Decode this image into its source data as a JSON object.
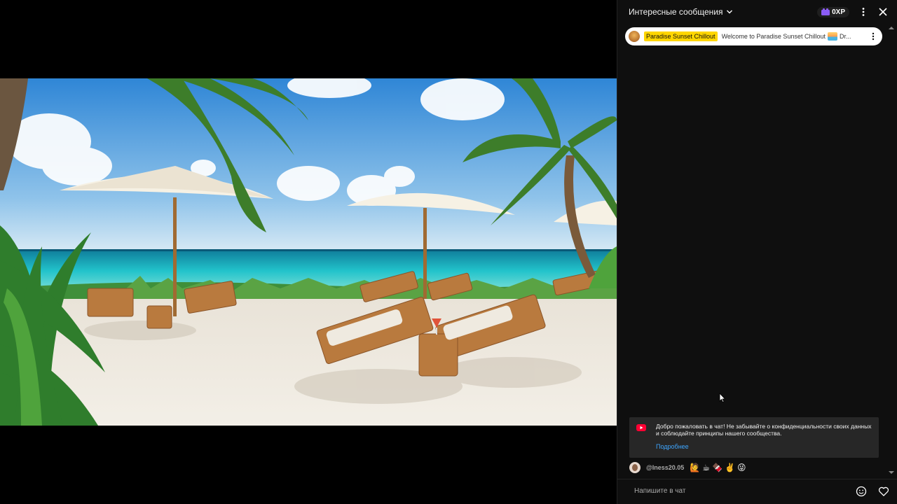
{
  "chat": {
    "header": {
      "title": "Интересные сообщения",
      "xp_label": "0XP"
    },
    "pinned": {
      "channel": "Paradise Sunset Chillout",
      "message": "Welcome to Paradise Sunset Chillout",
      "message_tail": "Dr..."
    },
    "welcome": {
      "text": "Добро пожаловать в чат! Не забывайте о конфиденциальности своих данных и соблюдайте принципы нашего сообщества.",
      "link": "Подробнее"
    },
    "messages": [
      {
        "author": "@Iness20.05",
        "emojis": [
          "🙋",
          "☕",
          "🍫",
          "✌️",
          "😜"
        ]
      }
    ],
    "input": {
      "placeholder": "Напишите в чат"
    }
  },
  "colors": {
    "chat_bg": "#0f0f0f",
    "pinned_channel_bg": "#ffd600",
    "link": "#3ea6ff",
    "welcome_bg": "#272727",
    "youtube_red": "#ff0033"
  },
  "icons": [
    "chevron-down-icon",
    "xp-icon",
    "more-vert-icon",
    "close-icon",
    "youtube-icon",
    "emoji-icon",
    "heart-icon",
    "scroll-arrow-icon"
  ]
}
